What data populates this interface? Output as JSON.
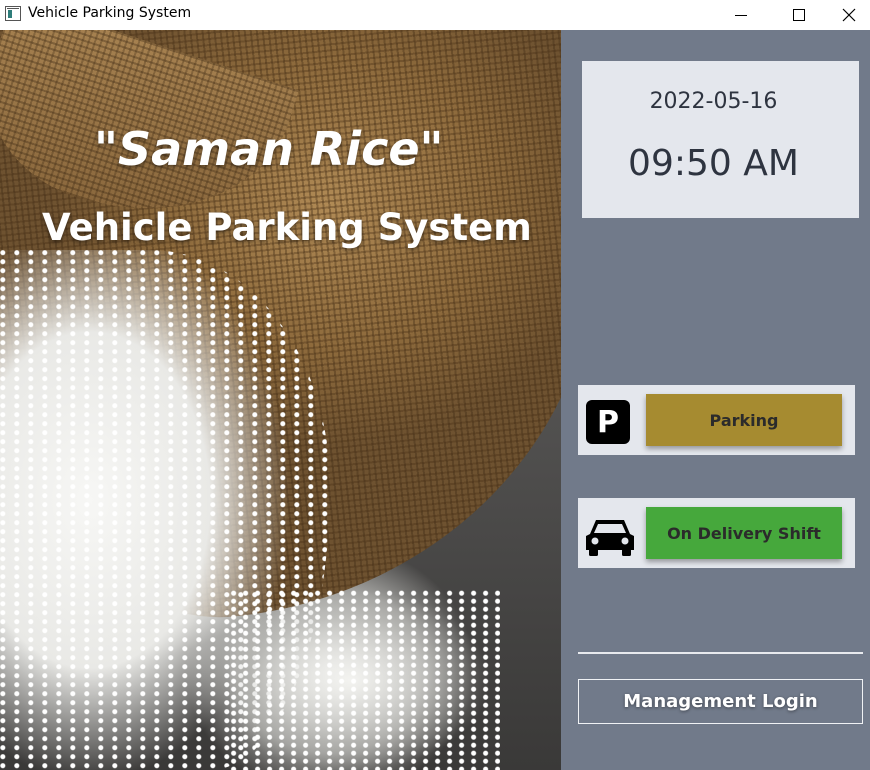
{
  "window": {
    "title": "Vehicle Parking System",
    "controls": {
      "minimize": "minimize-icon",
      "maximize": "maximize-icon",
      "close": "close-icon"
    }
  },
  "hero": {
    "quote_open": "\"",
    "company_name": "Saman Rice",
    "quote_close": "\"",
    "subtitle": "Vehicle Parking System"
  },
  "clock": {
    "date": "2022-05-16",
    "time": "09:50 AM"
  },
  "actions": {
    "parking": {
      "icon": "parking-sign-icon",
      "icon_letter": "P",
      "label": "Parking",
      "color": "#a68b30"
    },
    "delivery": {
      "icon": "car-icon",
      "label": "On Delivery Shift",
      "color": "#46a83c"
    }
  },
  "management": {
    "label": "Management Login"
  },
  "colors": {
    "side_panel": "#717a8a",
    "card": "#e4e7ed"
  }
}
